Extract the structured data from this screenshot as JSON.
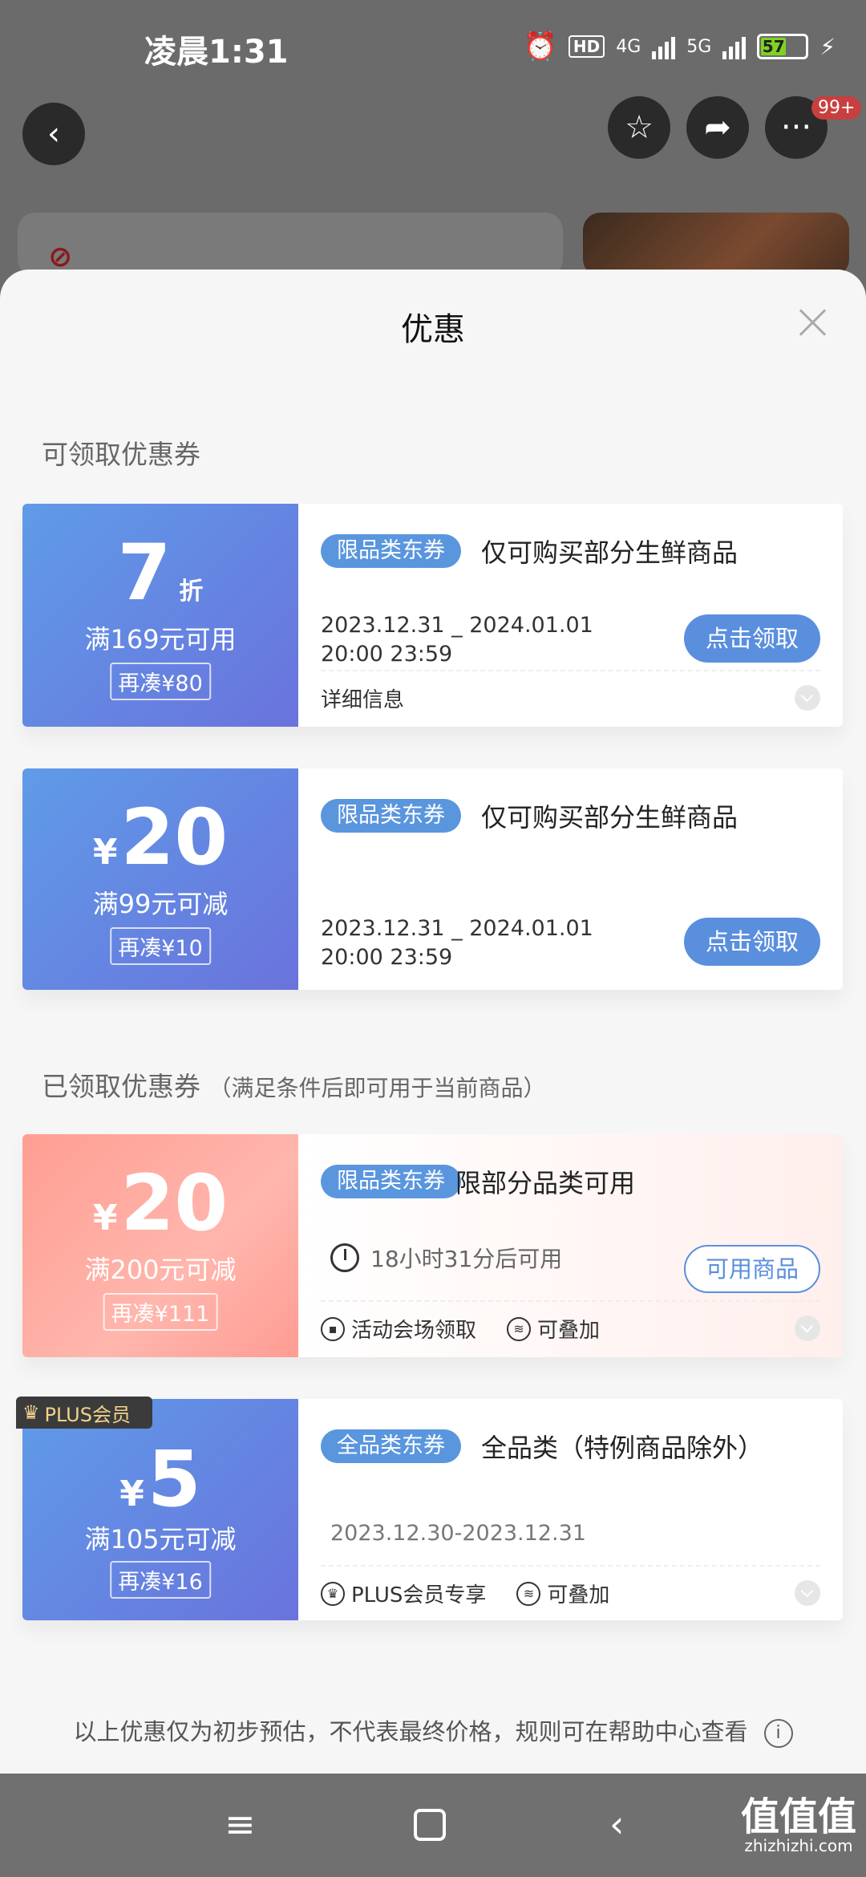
{
  "status": {
    "time": "凌晨1:31",
    "net1": "4G",
    "net2": "5G",
    "hd": "HD",
    "battery": "57"
  },
  "topbar": {
    "badge": "99+",
    "back_icon": "back-arrow-icon",
    "star_icon": "star-icon",
    "share_icon": "share-icon",
    "more_icon": "more-dots-icon"
  },
  "sheet": {
    "title": "优惠"
  },
  "sections": {
    "available": "可领取优惠券",
    "received": "已领取优惠券",
    "received_note": "（满足条件后即可用于当前商品）"
  },
  "coupons": [
    {
      "value": "7",
      "unit": "折",
      "condition": "满169元可用",
      "add": "再凑¥80",
      "tag": "限品类东券",
      "title": "仅可购买部分生鲜商品",
      "dates": "2023.12.31 _ 2024.01.01\n20:00 23:59",
      "button": "点击领取",
      "detail": "详细信息"
    },
    {
      "currency": "¥",
      "value": "20",
      "condition": "满99元可减",
      "add": "再凑¥10",
      "tag": "限品类东券",
      "title": "仅可购买部分生鲜商品",
      "dates": "2023.12.31 _ 2024.01.01\n20:00 23:59",
      "button": "点击领取"
    },
    {
      "currency": "¥",
      "value": "20",
      "condition": "满200元可减",
      "add": "再凑¥111",
      "tag": "限品类东券",
      "title": "限部分品类可用",
      "timer": "18小时31分后可用",
      "button": "可用商品",
      "info1": "活动会场领取",
      "info2": "可叠加"
    },
    {
      "currency": "¥",
      "value": "5",
      "condition": "满105元可减",
      "add": "再凑¥16",
      "tag": "全品类东券",
      "title": "全品类（特例商品除外）",
      "dates": "2023.12.30-2023.12.31",
      "ribbon": "PLUS会员",
      "info1": "PLUS会员专享",
      "info2": "可叠加"
    }
  ],
  "footer": {
    "note": "以上优惠仅为初步预估，不代表最终价格，规则可在帮助中心查看",
    "info_icon": "info-icon"
  },
  "watermark": {
    "logo": "值值值",
    "site": "zhizhizhi.com"
  }
}
